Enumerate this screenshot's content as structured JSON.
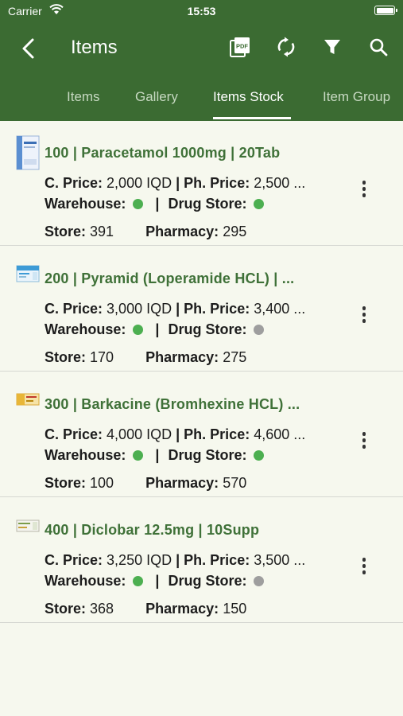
{
  "status": {
    "carrier": "Carrier",
    "time": "15:53"
  },
  "nav": {
    "title": "Items",
    "pdf_label": "PDF"
  },
  "tabs": [
    {
      "label": "Items"
    },
    {
      "label": "Gallery"
    },
    {
      "label": "Items Stock"
    },
    {
      "label": "Item Group"
    }
  ],
  "colors": {
    "primary": "#3b6b32",
    "available": "#4caf50",
    "unavailable": "#9e9e9e",
    "title": "#3f7138"
  },
  "labels": {
    "c_price": "C. Price:",
    "ph_price": "Ph. Price:",
    "warehouse": "Warehouse:",
    "drug_store": "Drug Store:",
    "store": "Store:",
    "pharmacy": "Pharmacy:",
    "separator": "|"
  },
  "items": [
    {
      "title": "100 | Paracetamol 1000mg | 20Tab",
      "c_price": "2,000 IQD",
      "ph_price": "2,500 ...",
      "warehouse": "available",
      "drug_store": "available",
      "store": "391",
      "pharmacy": "295"
    },
    {
      "title": "200 | Pyramid (Loperamide HCL) | ...",
      "c_price": "3,000 IQD",
      "ph_price": "3,400 ...",
      "warehouse": "available",
      "drug_store": "unavailable",
      "store": "170",
      "pharmacy": "275"
    },
    {
      "title": "300 | Barkacine (Bromhexine HCL) ...",
      "c_price": "4,000 IQD",
      "ph_price": "4,600 ...",
      "warehouse": "available",
      "drug_store": "available",
      "store": "100",
      "pharmacy": "570"
    },
    {
      "title": "400 | Diclobar 12.5mg | 10Supp",
      "c_price": "3,250 IQD",
      "ph_price": "3,500 ...",
      "warehouse": "available",
      "drug_store": "unavailable",
      "store": "368",
      "pharmacy": "150"
    }
  ]
}
